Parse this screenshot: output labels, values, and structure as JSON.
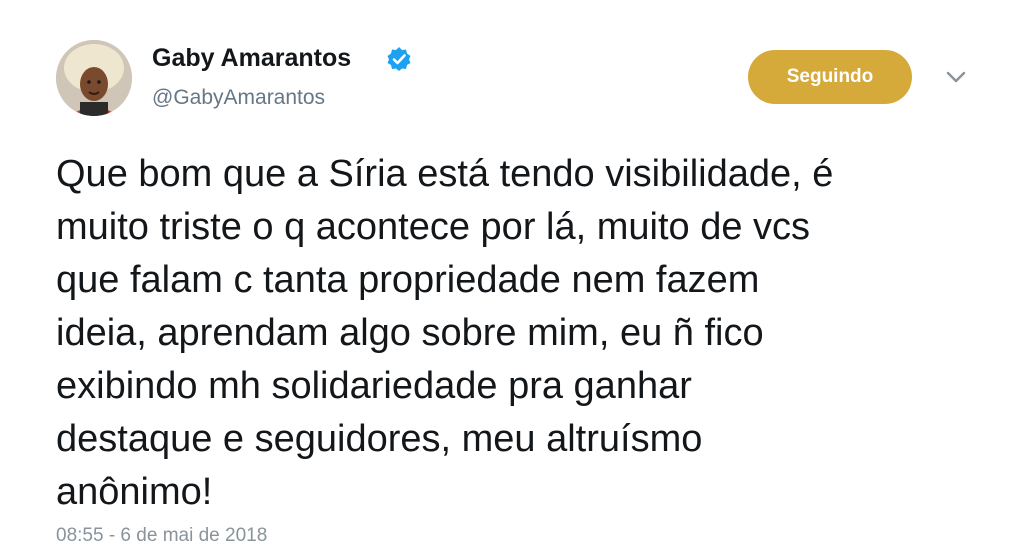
{
  "author": {
    "display_name": "Gaby Amarantos",
    "handle": "@GabyAmarantos",
    "verified_icon": "verified-badge-icon",
    "avatar_icon": "avatar"
  },
  "actions": {
    "follow_label": "Seguindo",
    "more_icon": "chevron-down-icon"
  },
  "tweet": {
    "lines": [
      "Que bom que a Síria está tendo visibilidade, é",
      "muito triste o q acontece por lá, muito de vcs",
      "que falam c tanta propriedade nem fazem",
      "ideia, aprendam algo sobre mim, eu ñ fico",
      "exibindo mh solidariedade pra ganhar",
      "destaque e seguidores, meu altruísmo",
      "anônimo!"
    ],
    "timestamp": "08:55 - 6 de mai de 2018"
  },
  "colors": {
    "follow_button": "#d6aa3a",
    "verified": "#1da1f2",
    "secondary_text": "#657786"
  }
}
